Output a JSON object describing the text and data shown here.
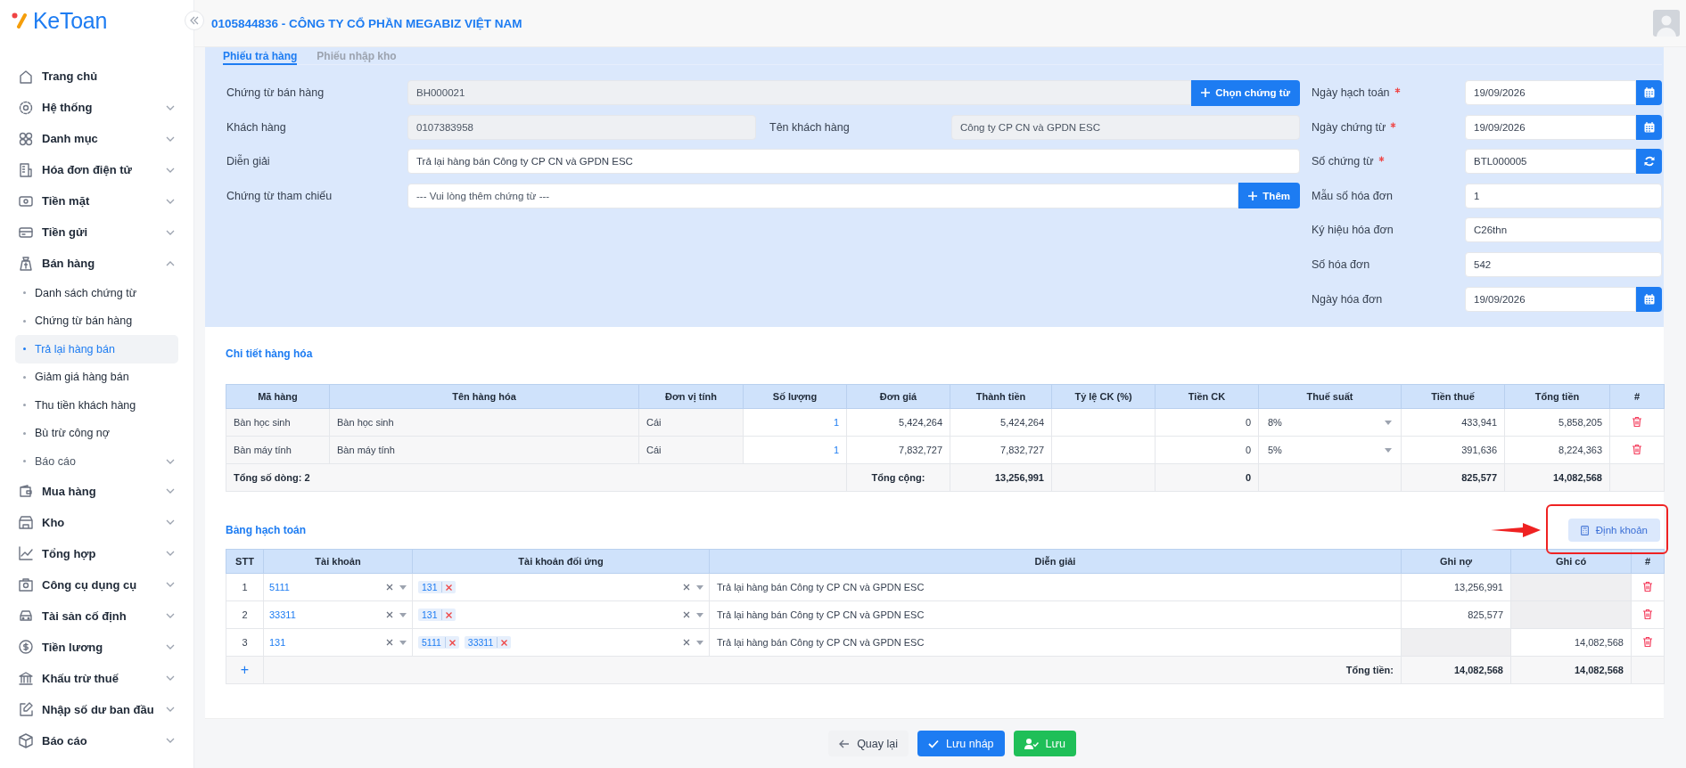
{
  "app": {
    "logo": "KeToan"
  },
  "sidebar": {
    "items": [
      {
        "label": "Trang chủ",
        "kind": "link"
      },
      {
        "label": "Hệ thống",
        "kind": "group",
        "expanded": false
      },
      {
        "label": "Danh mục",
        "kind": "group",
        "expanded": false
      },
      {
        "label": "Hóa đơn điện tử",
        "kind": "group",
        "expanded": false
      },
      {
        "label": "Tiền mặt",
        "kind": "group",
        "expanded": false
      },
      {
        "label": "Tiền gửi",
        "kind": "group",
        "expanded": false
      },
      {
        "label": "Bán hàng",
        "kind": "group",
        "expanded": true,
        "children": [
          {
            "label": "Danh sách chứng từ",
            "kind": "link",
            "selected": false
          },
          {
            "label": "Chứng từ bán hàng",
            "kind": "link",
            "selected": false
          },
          {
            "label": "Trả lại hàng bán",
            "kind": "link",
            "selected": true
          },
          {
            "label": "Giảm giá hàng bán",
            "kind": "link",
            "selected": false
          },
          {
            "label": "Thu tiền khách hàng",
            "kind": "link",
            "selected": false
          },
          {
            "label": "Bù trừ công nợ",
            "kind": "link",
            "selected": false
          },
          {
            "label": "Báo cáo",
            "kind": "group",
            "selected": false,
            "expanded": false
          }
        ]
      },
      {
        "label": "Mua hàng",
        "kind": "group",
        "expanded": false
      },
      {
        "label": "Kho",
        "kind": "group",
        "expanded": false
      },
      {
        "label": "Tổng hợp",
        "kind": "group",
        "expanded": false
      },
      {
        "label": "Công cụ dụng cụ",
        "kind": "group",
        "expanded": false
      },
      {
        "label": "Tài sản cố định",
        "kind": "group",
        "expanded": false
      },
      {
        "label": "Tiền lương",
        "kind": "group",
        "expanded": false
      },
      {
        "label": "Khấu trừ thuế",
        "kind": "group",
        "expanded": false
      },
      {
        "label": "Nhập số dư ban đầu",
        "kind": "group",
        "expanded": false
      },
      {
        "label": "Báo cáo",
        "kind": "group",
        "expanded": false
      }
    ]
  },
  "header": {
    "company": "0105844836 - CÔNG TY CỔ PHẦN MEGABIZ VIỆT NAM"
  },
  "tabs": [
    {
      "label": "Phiếu trả hàng",
      "selected": true
    },
    {
      "label": "Phiếu nhập kho",
      "selected": false
    }
  ],
  "voucher": {
    "label": "Chứng từ bán hàng",
    "value": "BH000021",
    "readonly": true,
    "button": "Chọn chứng từ"
  },
  "customer": {
    "code_label": "Khách hàng",
    "code": "0107383958",
    "name_label": "Tên khách hàng",
    "name": "Công ty CP CN và GPDN ESC",
    "readonly": true
  },
  "description": {
    "label": "Diễn giải",
    "value": "Trả lại hàng bán Công ty CP CN và GPDN ESC",
    "readonly": false
  },
  "reference": {
    "label": "Chứng từ tham chiếu",
    "placeholder": "--- Vui lòng thêm chứng từ ---",
    "button": "Thêm"
  },
  "right_fields": [
    {
      "label": "Ngày hạch toán",
      "required": true,
      "value": "19/09/2026",
      "kind": "date"
    },
    {
      "label": "Ngày chứng từ",
      "required": true,
      "value": "19/09/2026",
      "kind": "date"
    },
    {
      "label": "Số chứng từ",
      "required": true,
      "value": "BTL000005",
      "kind": "code"
    },
    {
      "label": "Mẫu số hóa đơn",
      "required": false,
      "value": "1",
      "kind": "text"
    },
    {
      "label": "Ký hiệu hóa đơn",
      "required": false,
      "value": "C26thn",
      "kind": "text"
    },
    {
      "label": "Số hóa đơn",
      "required": false,
      "value": "542",
      "kind": "text"
    },
    {
      "label": "Ngày hóa đơn",
      "required": false,
      "value": "19/09/2026",
      "kind": "date"
    }
  ],
  "goods": {
    "title": "Chi tiết hàng hóa",
    "columns": [
      "Mã hàng",
      "Tên hàng hóa",
      "Đơn vị tính",
      "Số lượng",
      "Đơn giá",
      "Thành tiền",
      "Tỷ lệ CK (%)",
      "Tiền CK",
      "Thuế suất",
      "Tiền thuế",
      "Tổng tiền",
      "#"
    ],
    "rows": [
      {
        "code": "Bàn học sinh",
        "name": "Bàn học sinh",
        "unit": "Cái",
        "qty": "1",
        "price": "5,424,264",
        "amount": "5,424,264",
        "discount": "0",
        "tax_rate": "8%",
        "tax": "433,941",
        "total": "5,858,205"
      },
      {
        "code": "Bàn máy tính",
        "name": "Bàn máy tính",
        "unit": "Cái",
        "qty": "1",
        "price": "7,832,727",
        "amount": "7,832,727",
        "discount": "0",
        "tax_rate": "5%",
        "tax": "391,636",
        "total": "8,224,363"
      }
    ],
    "footer": {
      "row_count": "Tổng số dòng: 2",
      "total_label": "Tổng cộng:",
      "amount": "13,256,991",
      "discount": "0",
      "tax": "825,577",
      "total": "14,082,568"
    }
  },
  "accounting": {
    "title": "Bảng hạch toán",
    "button": "Định khoản",
    "highlighted": true,
    "columns": [
      "STT",
      "Tài khoản",
      "Tài khoản đối ứng",
      "Diễn giải",
      "Ghi nợ",
      "Ghi có",
      "#"
    ],
    "rows": [
      {
        "stt": "1",
        "account": "5111",
        "contra": [
          "131"
        ],
        "description": "Trả lại hàng bán Công ty CP CN và GPDN ESC",
        "debit": "13,256,991"
      },
      {
        "stt": "2",
        "account": "33311",
        "contra": [
          "131"
        ],
        "description": "Trả lại hàng bán Công ty CP CN và GPDN ESC",
        "debit": "825,577"
      },
      {
        "stt": "3",
        "account": "131",
        "contra": [
          "5111",
          "33311"
        ],
        "description": "Trả lại hàng bán Công ty CP CN và GPDN ESC",
        "credit": "14,082,568"
      }
    ],
    "footer": {
      "add": "+",
      "total_label": "Tổng tiền:",
      "debit": "14,082,568",
      "credit": "14,082,568"
    }
  },
  "actions": [
    {
      "label": "Quay lại",
      "kind": "back"
    },
    {
      "label": "Lưu nháp",
      "kind": "draft"
    },
    {
      "label": "Lưu",
      "kind": "save"
    }
  ]
}
